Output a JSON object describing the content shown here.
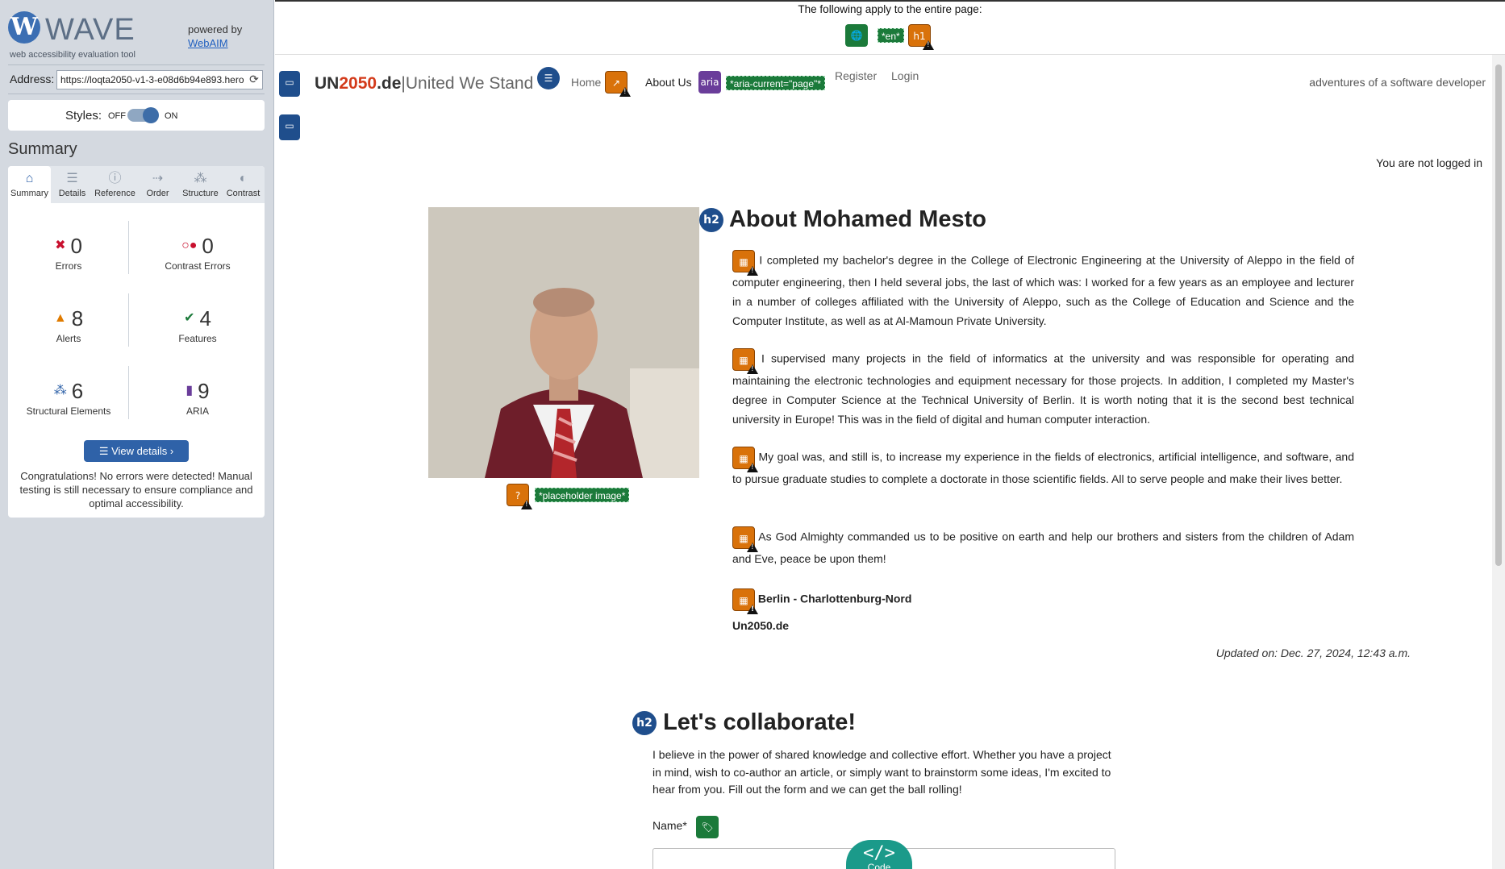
{
  "wave": {
    "logo_text": "WAVE",
    "tagline": "web accessibility evaluation tool",
    "powered_by": "powered by",
    "webaim_link": "WebAIM",
    "address_label": "Address:",
    "address_value": "https://loqta2050-v1-3-e08d6b94e893.hero",
    "styles_label": "Styles:",
    "styles_off": "OFF",
    "styles_on": "ON",
    "summary_title": "Summary",
    "tabs": [
      {
        "label": "Summary",
        "icon": "home-icon"
      },
      {
        "label": "Details",
        "icon": "list-icon"
      },
      {
        "label": "Reference",
        "icon": "info-icon"
      },
      {
        "label": "Order",
        "icon": "order-icon"
      },
      {
        "label": "Structure",
        "icon": "structure-icon"
      },
      {
        "label": "Contrast",
        "icon": "contrast-icon"
      }
    ],
    "stats": {
      "errors": {
        "value": "0",
        "label": "Errors"
      },
      "contrast_errors": {
        "value": "0",
        "label": "Contrast Errors"
      },
      "alerts": {
        "value": "8",
        "label": "Alerts"
      },
      "features": {
        "value": "4",
        "label": "Features"
      },
      "structural": {
        "value": "6",
        "label": "Structural Elements"
      },
      "aria": {
        "value": "9",
        "label": "ARIA"
      }
    },
    "view_details": "View details ›",
    "congrats": "Congratulations! No errors were detected! Manual testing is still necessary to ensure compliance and optimal accessibility."
  },
  "page": {
    "apply_text": "The following apply to the entire page:",
    "lang_tag": "*en*",
    "h1_icon": "h1",
    "brand_un": "UN",
    "brand_2050": "2050",
    "brand_de": ".de",
    "brand_sep": "|",
    "brand_sub": "United We Stand",
    "nav": {
      "home": "Home",
      "about": "About Us",
      "aria_icon": "aria",
      "aria_current": "*aria-current=\"page\"*",
      "register": "Register",
      "login": "Login"
    },
    "tagline": "adventures of a software developer",
    "logged_status": "You are not logged in",
    "h2_icon": "h2",
    "about_title": "About Mohamed Mesto",
    "placeholder_tag": "*placeholder image*",
    "paragraphs": [
      "I completed my bachelor's degree in the College of Electronic Engineering at the University of Aleppo in the field of computer engineering, then I held several jobs, the last of which was: I worked for a few years as an employee and lecturer in a number of colleges affiliated with the University of Aleppo, such as the College of Education and Science and the Computer Institute, as well as at Al-Mamoun Private University.",
      "I supervised many projects in the field of informatics at the university and was responsible for operating and maintaining the electronic technologies and equipment necessary for those projects. In addition, I completed my Master's degree in Computer Science at the Technical University of Berlin. It is worth noting that it is the second best technical university in Europe! This was in the field of digital and human computer interaction.",
      "My goal was, and still is, to increase my experience in the fields of electronics, artificial intelligence, and software, and to pursue graduate studies to complete a doctorate in those scientific fields. All to serve people and make their lives better.",
      "As God Almighty commanded us to be positive on earth and help our brothers and sisters from the children of Adam and Eve, peace be upon them!"
    ],
    "location": "Berlin - Charlottenburg-Nord",
    "site": "Un2050.de",
    "updated": "Updated on: Dec. 27, 2024, 12:43 a.m.",
    "collab_title": "Let's collaborate!",
    "collab_text": "I believe in the power of shared knowledge and collective effort. Whether you have a project in mind, wish to co-author an article, or simply want to brainstorm some ideas, I'm excited to hear from you. Fill out the form and we can get the ball rolling!",
    "name_label": "Name*",
    "code_icon": "</>",
    "code_label": "Code"
  },
  "colors": {
    "wave_blue": "#2f62a8",
    "feature_green": "#1b7a3a",
    "alert_orange": "#d9720a",
    "aria_purple": "#6a3d9a",
    "brand_red": "#d33a1a"
  }
}
